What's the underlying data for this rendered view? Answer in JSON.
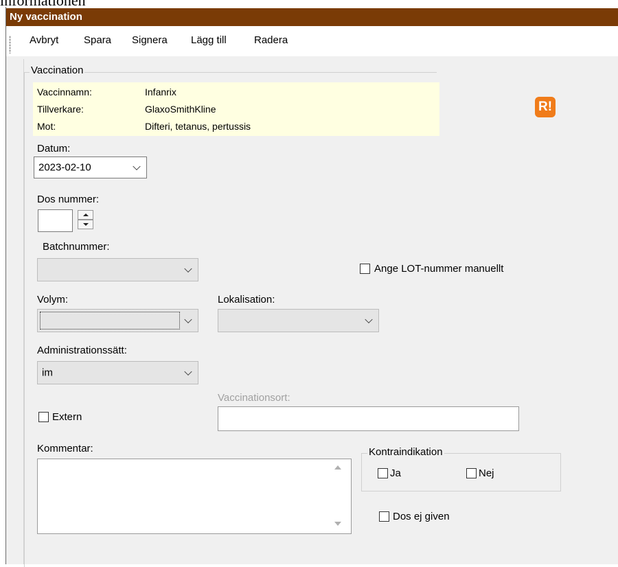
{
  "clipped_heading": "informationen",
  "window": {
    "title": "Ny vaccination"
  },
  "toolbar": {
    "cancel": "Avbryt",
    "save": "Spara",
    "sign": "Signera",
    "add": "Lägg till",
    "delete": "Radera"
  },
  "vaccination_group": {
    "title": "Vaccination",
    "info": {
      "name_label": "Vaccinnamn:",
      "name_value": "Infanrix",
      "maker_label": "Tillverkare:",
      "maker_value": "GlaxoSmithKline",
      "against_label": "Mot:",
      "against_value": "Difteri, tetanus, pertussis"
    },
    "badge": "R!"
  },
  "date": {
    "label": "Datum:",
    "value": "2023-02-10"
  },
  "dose": {
    "label": "Dos nummer:",
    "value": ""
  },
  "batch": {
    "label": "Batchnummer:",
    "value": ""
  },
  "lot_manual": {
    "label": "Ange LOT-nummer manuellt",
    "checked": false
  },
  "volume": {
    "label": "Volym:",
    "value": ""
  },
  "location": {
    "label": "Lokalisation:",
    "value": ""
  },
  "admin": {
    "label": "Administrationssätt:",
    "value": "im"
  },
  "vacc_place": {
    "label": "Vaccinationsort:",
    "value": ""
  },
  "external": {
    "label": "Extern",
    "checked": false
  },
  "comment": {
    "label": "Kommentar:",
    "value": ""
  },
  "contraindication": {
    "title": "Kontraindikation",
    "yes": "Ja",
    "no": "Nej"
  },
  "dose_not_given": {
    "label": "Dos ej given"
  }
}
